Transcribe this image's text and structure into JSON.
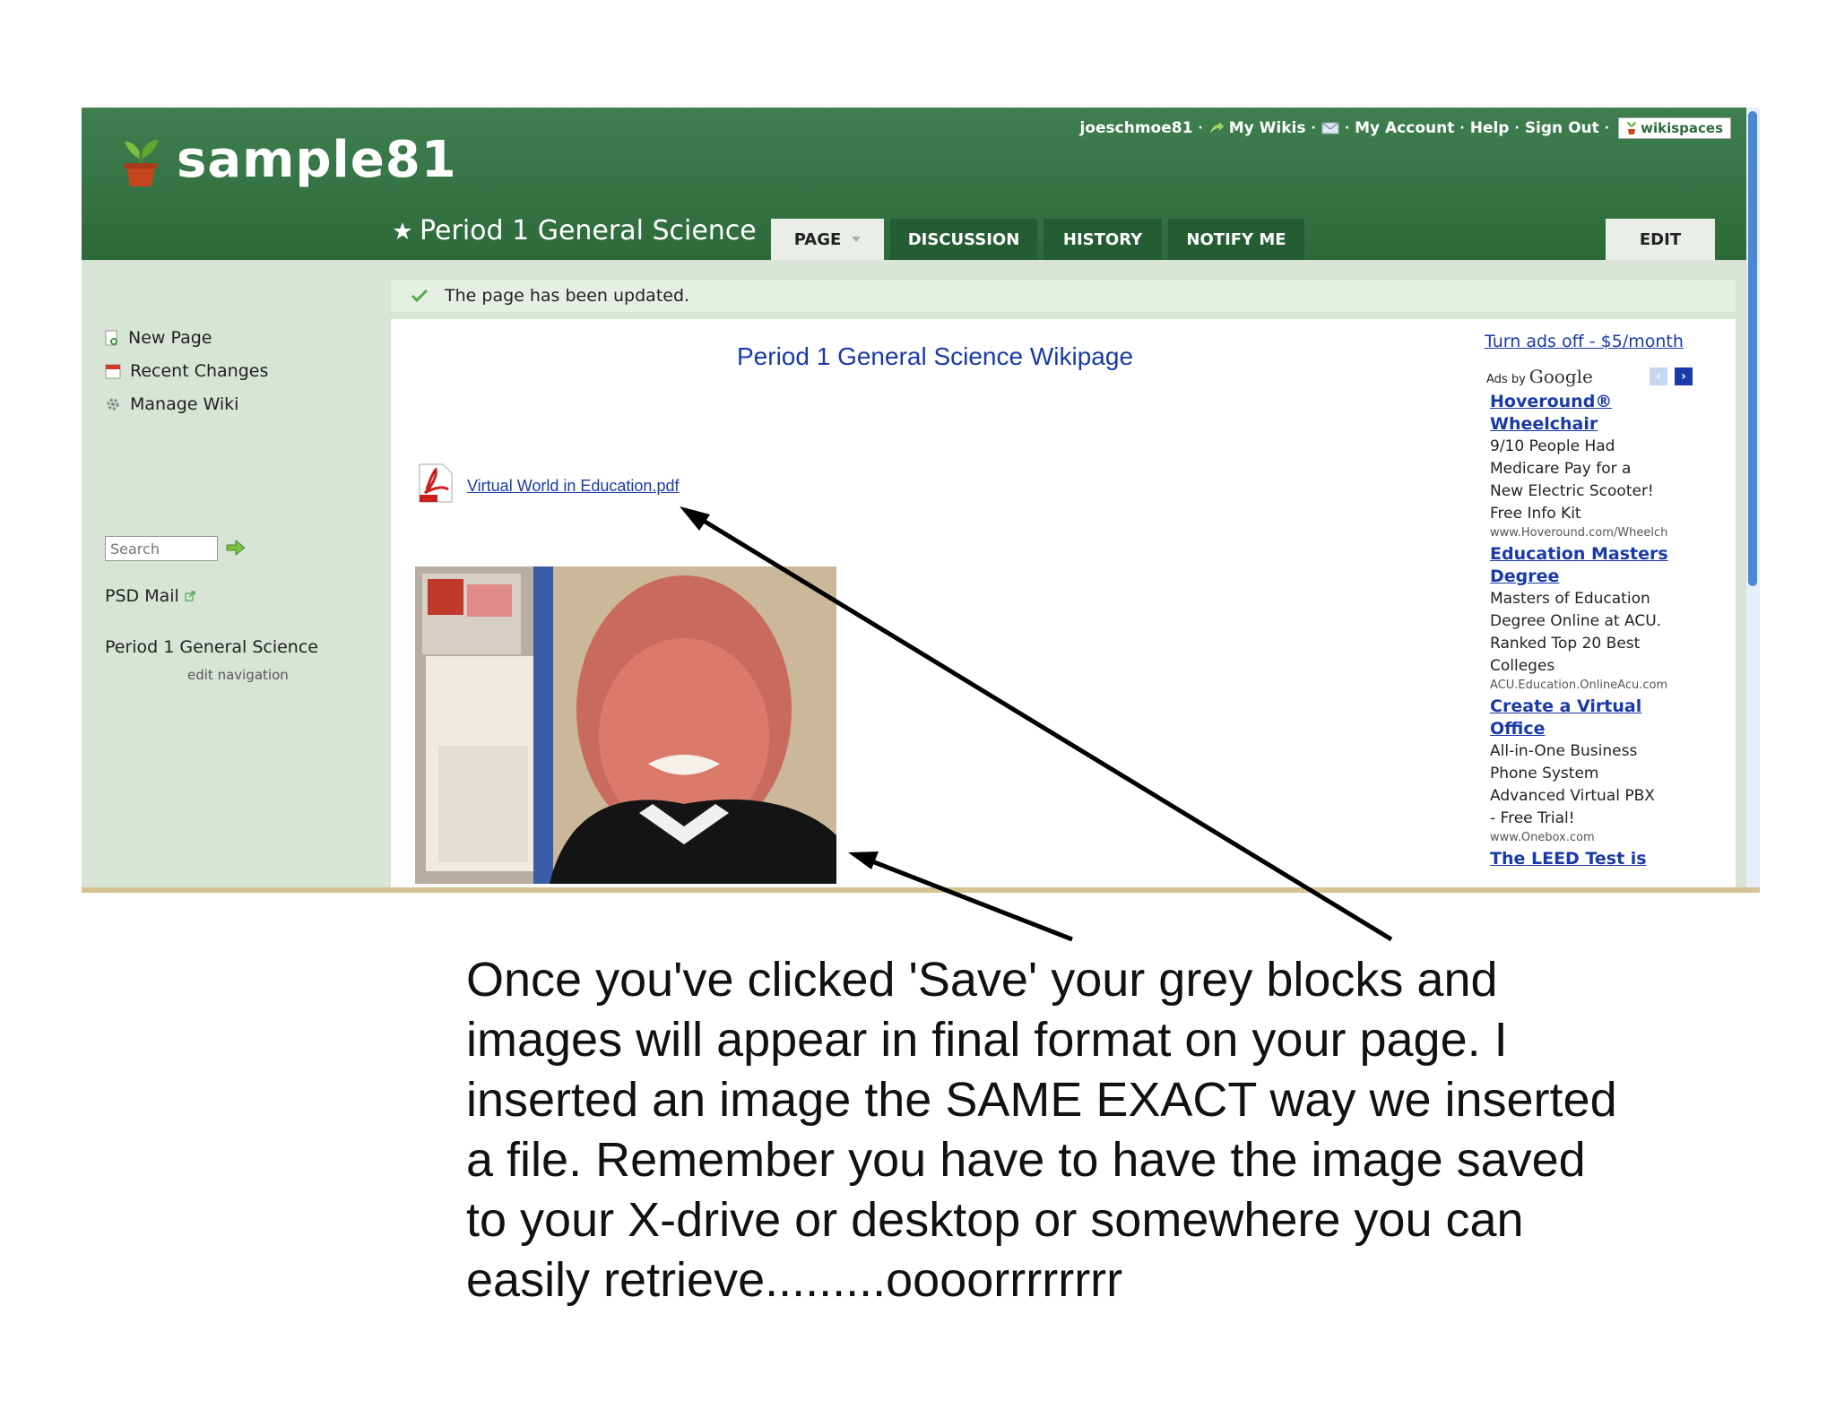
{
  "site": {
    "name": "sample81"
  },
  "topnav": {
    "user": "joeschmoe81",
    "my_wikis": "My Wikis",
    "my_account": "My Account",
    "help": "Help",
    "sign_out": "Sign Out",
    "badge": "wikispaces"
  },
  "page": {
    "title": "Period 1 General Science"
  },
  "tabs": {
    "page": "PAGE",
    "discussion": "DISCUSSION",
    "history": "HISTORY",
    "notify": "NOTIFY ME",
    "edit": "EDIT"
  },
  "sidebar": {
    "new_page": "New Page",
    "recent_changes": "Recent Changes",
    "manage_wiki": "Manage Wiki",
    "search_placeholder": "Search",
    "psd_mail": "PSD Mail",
    "period": "Period 1 General Science",
    "edit_navigation": "edit navigation"
  },
  "notice": "The page has been updated.",
  "content": {
    "heading": "Period 1 General Science Wikipage",
    "pdf_link": "Virtual World in Education.pdf"
  },
  "ads": {
    "turn_off": "Turn ads off - $5/month",
    "ads_by": "Ads by",
    "google": "Google",
    "items": [
      {
        "title": [
          "Hoveround®",
          "Wheelchair"
        ],
        "body": [
          "9/10 People Had",
          "Medicare Pay for a",
          "New Electric Scooter!",
          "Free Info Kit"
        ],
        "url": "www.Hoveround.com/Wheelch"
      },
      {
        "title": [
          "Education Masters",
          "Degree"
        ],
        "body": [
          "Masters of Education",
          "Degree Online at ACU.",
          "Ranked Top 20 Best",
          "Colleges"
        ],
        "url": "ACU.Education.OnlineAcu.com"
      },
      {
        "title": [
          "Create a Virtual",
          "Office"
        ],
        "body": [
          "All-in-One Business",
          "Phone System",
          "Advanced Virtual PBX",
          "- Free Trial!"
        ],
        "url": "www.Onebox.com"
      },
      {
        "title": [
          "The LEED Test is"
        ]
      }
    ]
  },
  "caption": [
    "Once you've clicked 'Save' your grey blocks and",
    "images will appear in final format on your page.  I",
    "inserted an image the SAME EXACT way we inserted",
    "a file.  Remember you have to have the image saved",
    "to your X-drive or desktop or somewhere you can",
    "easily retrieve.........oooorrrrrrrr"
  ],
  "colors": {
    "header_green": "#2d6a3a",
    "sidebar_bg": "#d7e4d6",
    "link_blue": "#1a3aa8"
  }
}
